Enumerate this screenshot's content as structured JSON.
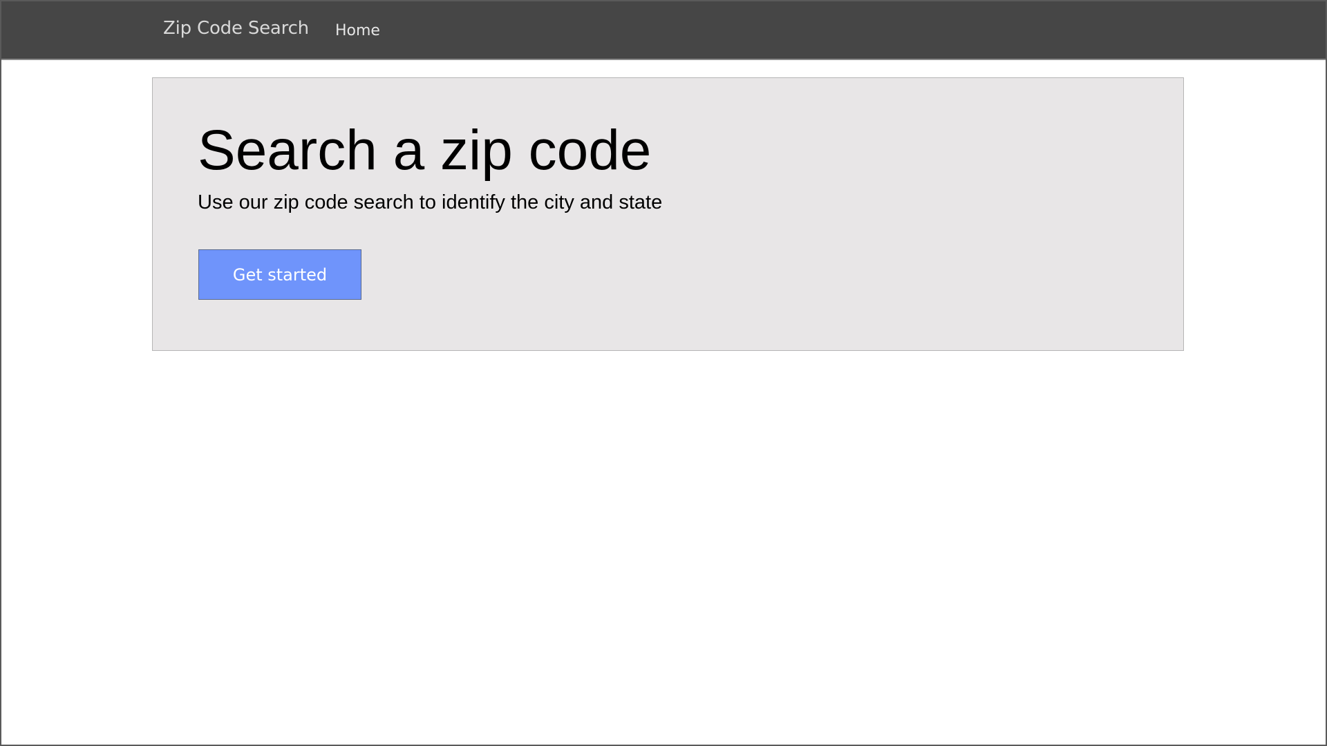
{
  "navbar": {
    "brand": "Zip Code Search",
    "links": [
      {
        "label": "Home"
      }
    ]
  },
  "hero": {
    "title": "Search a zip code",
    "subtitle": "Use our zip code search to identify the city and state",
    "cta_label": "Get started"
  },
  "colors": {
    "navbar_bg": "#464646",
    "jumbotron_bg": "#e8e6e7",
    "button_bg": "#6f94fb"
  }
}
